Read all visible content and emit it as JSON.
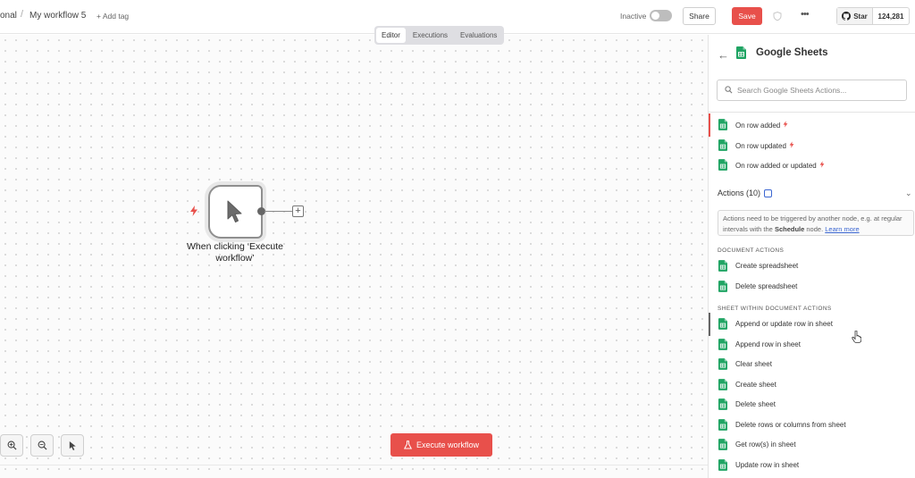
{
  "topbar": {
    "breadcrumb_prev": "onal",
    "workflow_name": "My workflow 5",
    "add_tag": "+ Add tag",
    "inactive_label": "Inactive",
    "share_label": "Share",
    "save_label": "Save",
    "github_star_label": "Star",
    "github_star_count": "124,281"
  },
  "canvas": {
    "tabs": [
      {
        "label": "Editor",
        "active": true
      },
      {
        "label": "Executions",
        "active": false
      },
      {
        "label": "Evaluations",
        "active": false
      }
    ],
    "node_label_line1": "When clicking ‘Execute",
    "node_label_line2": "workflow’",
    "execute_button": "Execute workflow"
  },
  "panel": {
    "title": "Google Sheets",
    "search_placeholder": "Search Google Sheets Actions...",
    "triggers": [
      {
        "label": "On row added"
      },
      {
        "label": "On row updated"
      },
      {
        "label": "On row added or updated"
      }
    ],
    "actions_heading": "Actions (10)",
    "notice_prefix": "Actions need to be triggered by another node, e.g. at regular intervals with the",
    "notice_bold": "Schedule",
    "notice_mid": "node.",
    "notice_link": "Learn more",
    "document_section": "DOCUMENT ACTIONS",
    "document_actions": [
      {
        "label": "Create spreadsheet"
      },
      {
        "label": "Delete spreadsheet"
      }
    ],
    "sheet_section": "SHEET WITHIN DOCUMENT ACTIONS",
    "sheet_actions": [
      {
        "label": "Append or update row in sheet"
      },
      {
        "label": "Append row in sheet"
      },
      {
        "label": "Clear sheet"
      },
      {
        "label": "Create sheet"
      },
      {
        "label": "Delete sheet"
      },
      {
        "label": "Delete rows or columns from sheet"
      },
      {
        "label": "Get row(s) in sheet"
      },
      {
        "label": "Update row in sheet"
      }
    ]
  },
  "colors": {
    "accent_red": "#e8504b",
    "sheets_green": "#1fa463",
    "link_blue": "#3b66d1"
  }
}
